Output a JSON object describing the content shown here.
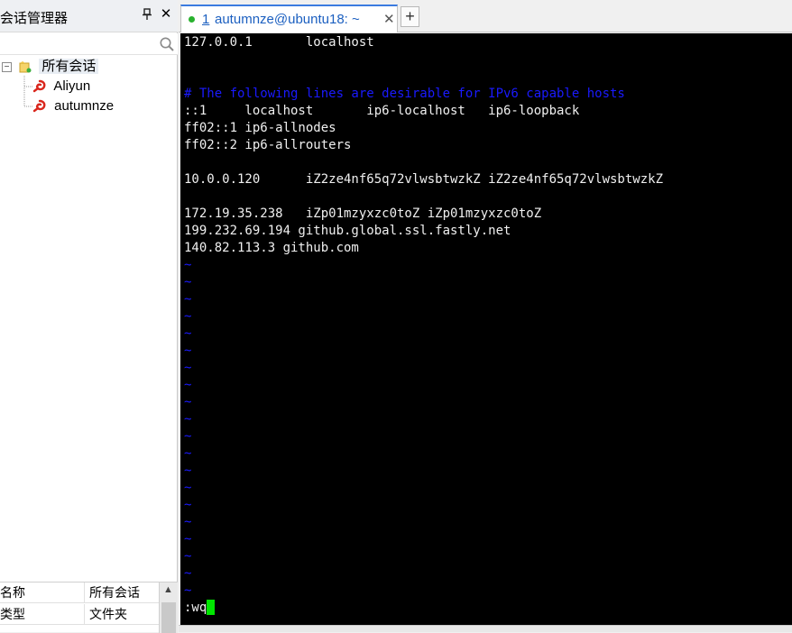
{
  "session_manager": {
    "title": "会话管理器",
    "pin_icon": "pin-icon",
    "close_icon": "close-icon",
    "search_placeholder": "",
    "tree": {
      "root_label": "所有会话",
      "root_expander": "−",
      "sessions": [
        {
          "label": "Aliyun"
        },
        {
          "label": "autumnze"
        }
      ]
    },
    "properties": [
      {
        "key": "名称",
        "value": "所有会话"
      },
      {
        "key": "类型",
        "value": "文件夹"
      }
    ]
  },
  "tabs": {
    "active": {
      "number": "1",
      "title": "autumnze@ubuntu18: ~",
      "status_color": "#29b22e"
    },
    "add_label": "+"
  },
  "terminal": {
    "lines": [
      "127.0.0.1       localhost",
      "",
      "",
      "# The following lines are desirable for IPv6 capable hosts",
      "::1     localhost       ip6-localhost   ip6-loopback",
      "ff02::1 ip6-allnodes",
      "ff02::2 ip6-allrouters",
      "",
      "10.0.0.120      iZ2ze4nf65q72vlwsbtwzkZ iZ2ze4nf65q72vlwsbtwzkZ",
      "",
      "172.19.35.238   iZp01mzyxzc0toZ iZp01mzyxzc0toZ",
      "199.232.69.194 github.global.ssl.fastly.net",
      "140.82.113.3 github.com"
    ],
    "comment_line_index": 3,
    "tilde": "~",
    "tilde_count": 20,
    "command": ":wq",
    "colors": {
      "background": "#000000",
      "text": "#f0f0f0",
      "comment": "#1a1aff",
      "cursor": "#00e600"
    }
  }
}
